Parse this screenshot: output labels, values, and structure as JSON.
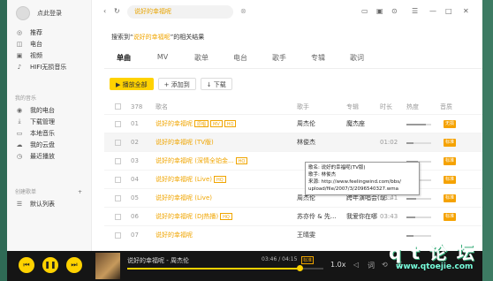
{
  "user": {
    "login_label": "点此登录"
  },
  "nav": {
    "main": [
      "推荐",
      "电台",
      "视频",
      "HIFI无损音乐"
    ],
    "my_music_title": "我的音乐",
    "my_music": [
      "我的电台",
      "下载管理",
      "本地音乐",
      "我的云盘",
      "最近播放"
    ],
    "playlist_title": "创建歌单",
    "playlists": [
      "默认列表"
    ]
  },
  "search": {
    "value": "说好的幸福呢"
  },
  "result": {
    "prefix": "搜索到“",
    "keyword": "说好的幸福呢",
    "suffix": "”的相关结果"
  },
  "tabs": [
    "单曲",
    "MV",
    "歌单",
    "电台",
    "歌手",
    "专辑",
    "歌词"
  ],
  "actions": {
    "play_all": "▶ 播放全部",
    "add_to": "+ 添加到",
    "download": "↓ 下载"
  },
  "table": {
    "count": "378",
    "headers": {
      "song": "歌名",
      "singer": "歌手",
      "album": "专辑",
      "duration": "时长",
      "heat": "热度",
      "source": "音质"
    },
    "rows": [
      {
        "num": "01",
        "title": "说好的幸福呢",
        "singer": "周杰伦",
        "album": "魔杰座",
        "duration": "",
        "heat": 0.8,
        "tags": [
          "原唱",
          "MV",
          "HQ"
        ],
        "source": "无损"
      },
      {
        "num": "02",
        "title": "说好的幸福呢 (TV版)",
        "singer": "林俊杰",
        "album": "",
        "duration": "01:02",
        "heat": 0.3,
        "tags": [],
        "source": "标准"
      },
      {
        "num": "03",
        "title": "说好的幸福呢 (深情全铂金...",
        "singer": "",
        "album": "",
        "duration": "",
        "heat": 0.45,
        "tags": [
          "HQ"
        ],
        "source": "标准"
      },
      {
        "num": "04",
        "title": "说好的幸福呢 (Live)",
        "singer": "",
        "album": "",
        "duration": "",
        "heat": 0.5,
        "tags": [
          "HQ"
        ],
        "source": "标准"
      },
      {
        "num": "05",
        "title": "说好的幸福呢 (Live)",
        "singer": "周杰伦",
        "album": "跨年演唱会(现...",
        "duration": "03:41",
        "heat": 0.4,
        "tags": [],
        "source": "标准"
      },
      {
        "num": "06",
        "title": "说好的幸福呢 (DJ热播)",
        "singer": "苏亦伶 & 先...",
        "album": "我爱你在哪",
        "duration": "03:43",
        "heat": 0.35,
        "tags": [
          "HQ"
        ],
        "source": "标准"
      },
      {
        "num": "07",
        "title": "说好的幸福呢",
        "singer": "王晴雯",
        "album": "",
        "duration": "",
        "heat": 0.3,
        "tags": [],
        "source": ""
      }
    ]
  },
  "tooltip": {
    "line1": "歌名: 说好的幸福呢(TV版)",
    "line2": "歌手: 林俊杰",
    "line3": "来源: http://www.feelingwind.com/bbs/",
    "line4": "upload/file/2007/3/2096540327.wma"
  },
  "player": {
    "title": "说好的幸福呢 - 周杰伦",
    "time": "03:46 / 04:15",
    "quality": "标准",
    "progress": 0.88,
    "speed": "1.0x"
  },
  "watermark": {
    "line1": "q t 论 坛",
    "line2": "www.qtoejie.com"
  },
  "colors": {
    "accent": "#ffd200",
    "song": "#f0a500",
    "player_bg": "#151515"
  }
}
